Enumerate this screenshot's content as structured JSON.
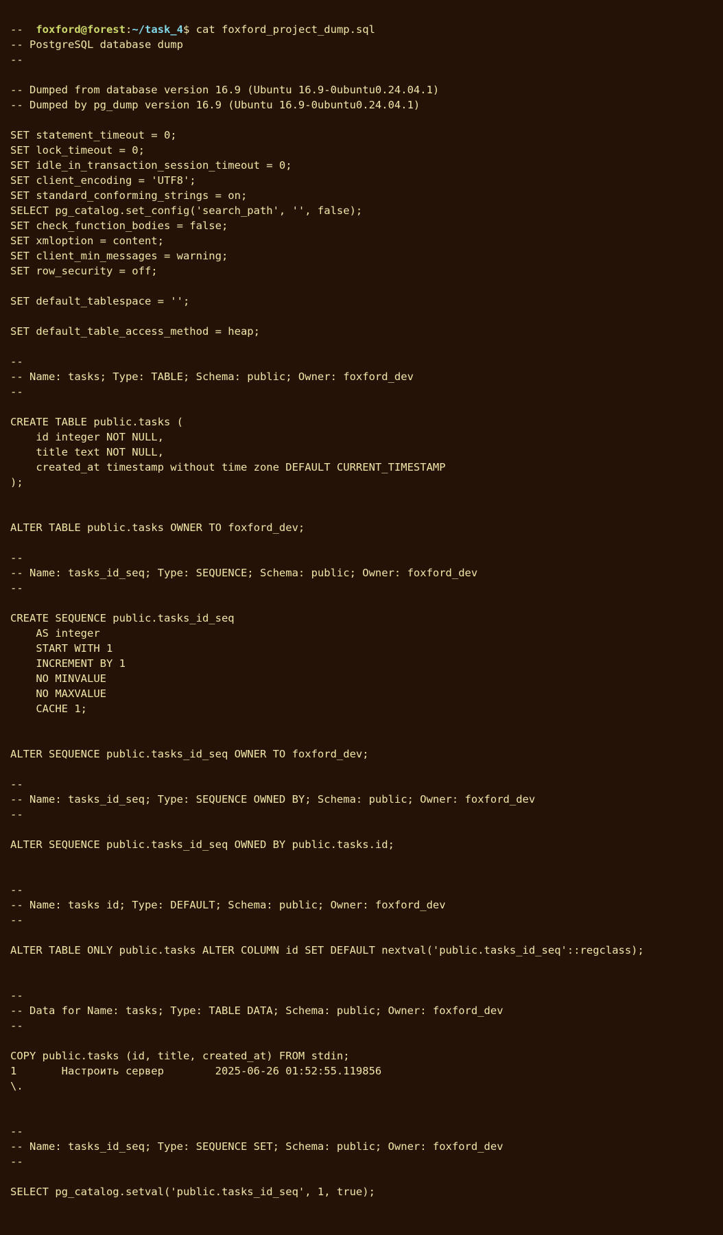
{
  "terminal": {
    "prompt": {
      "user_host": "foxford@forest",
      "separator": ":",
      "path": "~/task_4",
      "symbol": "$",
      "command": " cat foxford_project_dump.sql"
    },
    "output": [
      "--",
      "-- PostgreSQL database dump",
      "--",
      "",
      "-- Dumped from database version 16.9 (Ubuntu 16.9-0ubuntu0.24.04.1)",
      "-- Dumped by pg_dump version 16.9 (Ubuntu 16.9-0ubuntu0.24.04.1)",
      "",
      "SET statement_timeout = 0;",
      "SET lock_timeout = 0;",
      "SET idle_in_transaction_session_timeout = 0;",
      "SET client_encoding = 'UTF8';",
      "SET standard_conforming_strings = on;",
      "SELECT pg_catalog.set_config('search_path', '', false);",
      "SET check_function_bodies = false;",
      "SET xmloption = content;",
      "SET client_min_messages = warning;",
      "SET row_security = off;",
      "",
      "SET default_tablespace = '';",
      "",
      "SET default_table_access_method = heap;",
      "",
      "--",
      "-- Name: tasks; Type: TABLE; Schema: public; Owner: foxford_dev",
      "--",
      "",
      "CREATE TABLE public.tasks (",
      "    id integer NOT NULL,",
      "    title text NOT NULL,",
      "    created_at timestamp without time zone DEFAULT CURRENT_TIMESTAMP",
      ");",
      "",
      "",
      "ALTER TABLE public.tasks OWNER TO foxford_dev;",
      "",
      "--",
      "-- Name: tasks_id_seq; Type: SEQUENCE; Schema: public; Owner: foxford_dev",
      "--",
      "",
      "CREATE SEQUENCE public.tasks_id_seq",
      "    AS integer",
      "    START WITH 1",
      "    INCREMENT BY 1",
      "    NO MINVALUE",
      "    NO MAXVALUE",
      "    CACHE 1;",
      "",
      "",
      "ALTER SEQUENCE public.tasks_id_seq OWNER TO foxford_dev;",
      "",
      "--",
      "-- Name: tasks_id_seq; Type: SEQUENCE OWNED BY; Schema: public; Owner: foxford_dev",
      "--",
      "",
      "ALTER SEQUENCE public.tasks_id_seq OWNED BY public.tasks.id;",
      "",
      "",
      "--",
      "-- Name: tasks id; Type: DEFAULT; Schema: public; Owner: foxford_dev",
      "--",
      "",
      "ALTER TABLE ONLY public.tasks ALTER COLUMN id SET DEFAULT nextval('public.tasks_id_seq'::regclass);",
      "",
      "",
      "--",
      "-- Data for Name: tasks; Type: TABLE DATA; Schema: public; Owner: foxford_dev",
      "--",
      "",
      "COPY public.tasks (id, title, created_at) FROM stdin;",
      "1       Настроить сервер        2025-06-26 01:52:55.119856",
      "\\.",
      "",
      "",
      "--",
      "-- Name: tasks_id_seq; Type: SEQUENCE SET; Schema: public; Owner: foxford_dev",
      "--",
      "",
      "SELECT pg_catalog.setval('public.tasks_id_seq', 1, true);",
      "",
      "",
      ""
    ]
  }
}
